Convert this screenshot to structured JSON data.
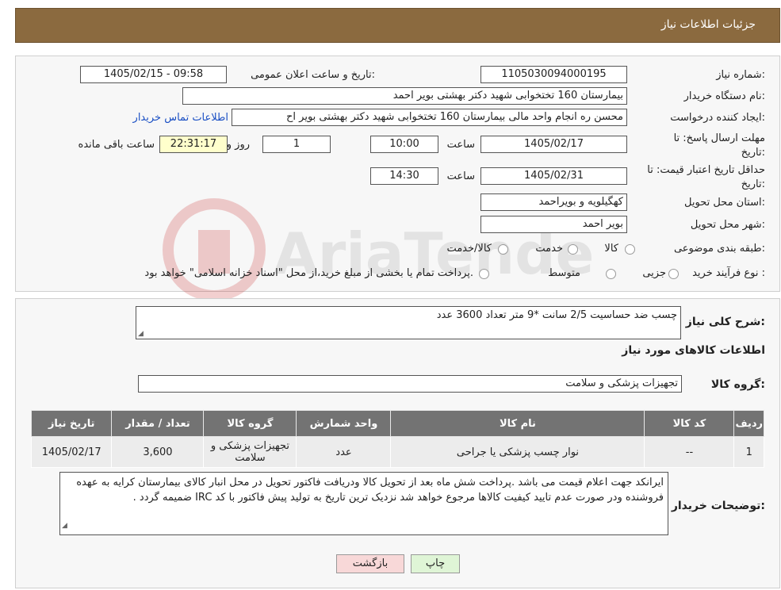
{
  "header": {
    "title": "جزئیات اطلاعات نیاز"
  },
  "form": {
    "need_number_label": "شماره نیاز:",
    "need_number": "1105030094000195",
    "announce_label": "تاریخ و ساعت اعلان عمومی:",
    "announce_value": "1405/02/15 - 09:58",
    "buyer_org_label": "نام دستگاه خریدار:",
    "buyer_org": "بیمارستان 160 تختخوابی شهید دکتر بهشتی بویر احمد",
    "requester_label": "ایجاد کننده درخواست:",
    "requester": "محسن ره انجام واحد مالی بیمارستان 160 تختخوابی شهید دکتر بهشتی بویر اح",
    "contact_link": "اطلاعات تماس خریدار",
    "deadline_label_1": "مهلت ارسال پاسخ: تا",
    "deadline_label_2": "تاریخ:",
    "deadline_date": "1405/02/17",
    "time_label": "ساعت",
    "deadline_time": "10:00",
    "days_value": "1",
    "days_label": "روز و",
    "remaining_time": "22:31:17",
    "remaining_label": "ساعت باقی مانده",
    "validity_label_1": "حداقل تاریخ اعتبار قیمت: تا",
    "validity_label_2": "تاریخ:",
    "validity_date": "1405/02/31",
    "validity_time": "14:30",
    "province_label": "استان محل تحویل:",
    "province": "کهگیلویه و بویراحمد",
    "city_label": "شهر محل تحویل:",
    "city": "بویر احمد",
    "category_label": "طبقه بندی موضوعی:",
    "category_options": [
      "کالا",
      "خدمت",
      "کالا/خدمت"
    ],
    "process_label": "نوع فرآیند خرید :",
    "process_options": [
      "جزیی",
      "متوسط"
    ],
    "process_note": "پرداخت تمام یا بخشی از مبلغ خرید،از محل \"اسناد خزانه اسلامی\" خواهد بود."
  },
  "watermark": {
    "text": "AriaTender.neT"
  },
  "details": {
    "summary_label": "شرح کلی نیاز:",
    "summary": "چسب ضد حساسیت 2/5 سانت *9 متر تعداد 3600 عدد",
    "goods_info_title": "اطلاعات کالاهای مورد نیاز",
    "goods_group_label": "گروه کالا:",
    "goods_group": "تجهیزات پزشکی و سلامت"
  },
  "table": {
    "headers": [
      "ردیف",
      "کد کالا",
      "نام کالا",
      "واحد شمارش",
      "گروه کالا",
      "تعداد / مقدار",
      "تاریخ نیاز"
    ],
    "rows": [
      [
        "1",
        "--",
        "نوار چسب پزشکی یا جراحی",
        "عدد",
        "تجهیزات پزشکی و سلامت",
        "3,600",
        "1405/02/17"
      ]
    ]
  },
  "buyer_notes": {
    "label": "توضیحات خریدار:",
    "text": "ایرانکد جهت اعلام قیمت می باشد .پرداخت شش ماه بعد از تحویل کالا ودریافت فاکتور تحویل در محل انبار کالای بیمارستان کرایه به عهده فروشنده ودر صورت عدم تایید کیفیت کالاها مرجوع خواهد شد نزدیک ترین تاریخ به تولید پیش فاکتور با کد IRC ضمیمه گردد ."
  },
  "buttons": {
    "print": "چاپ",
    "back": "بازگشت"
  },
  "colors": {
    "header_bg": "#8B6A3F",
    "table_header": "#737373",
    "link": "#1a4fc4",
    "back_bg": "#f8d8d8",
    "print_bg": "#dff5d6"
  }
}
